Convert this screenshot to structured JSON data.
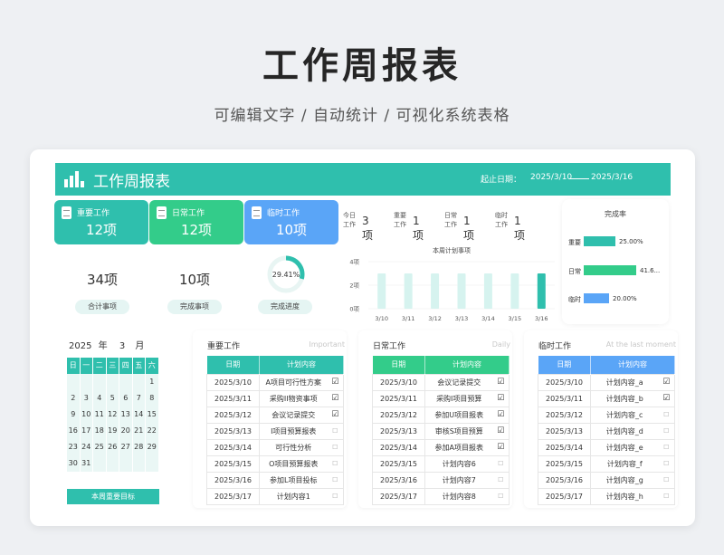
{
  "page": {
    "title": "工作周报表",
    "subtitle": "可编辑文字 / 自动统计 / 可视化系统表格"
  },
  "colors": {
    "teal": "#2fbfad",
    "green": "#33cc8a",
    "blue": "#5aa5f7"
  },
  "banner": {
    "title": "工作周报表",
    "date_label": "起止日期：",
    "start": "2025/3/10",
    "end": "2025/3/16"
  },
  "categories": [
    {
      "name": "重要工作",
      "count": "12项",
      "icon": "document-icon"
    },
    {
      "name": "日常工作",
      "count": "12项",
      "icon": "document-icon"
    },
    {
      "name": "临时工作",
      "count": "10项",
      "icon": "document-icon"
    }
  ],
  "stats": {
    "total": {
      "value": "34项",
      "label": "合计事项"
    },
    "done": {
      "value": "10项",
      "label": "完成事项"
    },
    "progress": {
      "value": "29.41%",
      "label": "完成进度",
      "fraction": 0.2941
    }
  },
  "today": [
    {
      "label": "今日工作",
      "value": "3项"
    },
    {
      "label": "重要工作",
      "value": "1项"
    },
    {
      "label": "日常工作",
      "value": "1项"
    },
    {
      "label": "临时工作",
      "value": "1项"
    }
  ],
  "chart_data": {
    "type": "bar",
    "title": "本周计划事项",
    "categories": [
      "3/10",
      "3/11",
      "3/12",
      "3/13",
      "3/14",
      "3/15",
      "3/16"
    ],
    "values": [
      3,
      3,
      3,
      3,
      3,
      3,
      3
    ],
    "highlighted": [
      "3/16"
    ],
    "y_ticks": [
      "0项",
      "2项",
      "4项"
    ],
    "ylim": [
      0,
      4
    ]
  },
  "completion_rate": {
    "title": "完成率",
    "rows": [
      {
        "label": "重要",
        "pct": "25.00%",
        "fraction": 0.25,
        "color": "#2fbfad"
      },
      {
        "label": "日常",
        "pct": "41.6...",
        "fraction": 0.4167,
        "color": "#33cc8a"
      },
      {
        "label": "临时",
        "pct": "20.00%",
        "fraction": 0.2,
        "color": "#5aa5f7"
      }
    ]
  },
  "calendar": {
    "year": "2025",
    "year_suffix": "年",
    "month": "3",
    "month_suffix": "月",
    "weekdays": [
      "日",
      "一",
      "二",
      "三",
      "四",
      "五",
      "六"
    ],
    "weeks": [
      [
        "",
        "",
        "",
        "",
        "",
        "",
        "1"
      ],
      [
        "2",
        "3",
        "4",
        "5",
        "6",
        "7",
        "8"
      ],
      [
        "9",
        "10",
        "11",
        "12",
        "13",
        "14",
        "15"
      ],
      [
        "16",
        "17",
        "18",
        "19",
        "20",
        "21",
        "22"
      ],
      [
        "23",
        "24",
        "25",
        "26",
        "27",
        "28",
        "29"
      ],
      [
        "30",
        "31",
        "",
        "",
        "",
        "",
        ""
      ]
    ],
    "goal_button": "本周重要目标"
  },
  "task_headers": {
    "date": "日期",
    "content": "计划内容"
  },
  "tasks": [
    {
      "title": "重要工作",
      "subtitle": "Important",
      "color": "#2fbfad",
      "rows": [
        {
          "date": "2025/3/10",
          "content": "A项目可行性方案",
          "done": true
        },
        {
          "date": "2025/3/11",
          "content": "采购II物资事项",
          "done": true
        },
        {
          "date": "2025/3/12",
          "content": "会议记录提交",
          "done": true
        },
        {
          "date": "2025/3/13",
          "content": "I项目预算报表",
          "done": false
        },
        {
          "date": "2025/3/14",
          "content": "可行性分析",
          "done": false
        },
        {
          "date": "2025/3/15",
          "content": "O项目预算报表",
          "done": false
        },
        {
          "date": "2025/3/16",
          "content": "参加L项目投标",
          "done": false
        },
        {
          "date": "2025/3/17",
          "content": "计划内容1",
          "done": false
        }
      ]
    },
    {
      "title": "日常工作",
      "subtitle": "Daily",
      "color": "#33cc8a",
      "rows": [
        {
          "date": "2025/3/10",
          "content": "会议记录提交",
          "done": true
        },
        {
          "date": "2025/3/11",
          "content": "采购I项目预算",
          "done": true
        },
        {
          "date": "2025/3/12",
          "content": "参加U项目报表",
          "done": true
        },
        {
          "date": "2025/3/13",
          "content": "审核S项目预算",
          "done": true
        },
        {
          "date": "2025/3/14",
          "content": "参加A项目报表",
          "done": true
        },
        {
          "date": "2025/3/15",
          "content": "计划内容6",
          "done": false
        },
        {
          "date": "2025/3/16",
          "content": "计划内容7",
          "done": false
        },
        {
          "date": "2025/3/17",
          "content": "计划内容8",
          "done": false
        }
      ]
    },
    {
      "title": "临时工作",
      "subtitle": "At the last moment",
      "color": "#5aa5f7",
      "rows": [
        {
          "date": "2025/3/10",
          "content": "计划内容_a",
          "done": true
        },
        {
          "date": "2025/3/11",
          "content": "计划内容_b",
          "done": true
        },
        {
          "date": "2025/3/12",
          "content": "计划内容_c",
          "done": false
        },
        {
          "date": "2025/3/13",
          "content": "计划内容_d",
          "done": false
        },
        {
          "date": "2025/3/14",
          "content": "计划内容_e",
          "done": false
        },
        {
          "date": "2025/3/15",
          "content": "计划内容_f",
          "done": false
        },
        {
          "date": "2025/3/16",
          "content": "计划内容_g",
          "done": false
        },
        {
          "date": "2025/3/17",
          "content": "计划内容_h",
          "done": false
        }
      ]
    }
  ]
}
